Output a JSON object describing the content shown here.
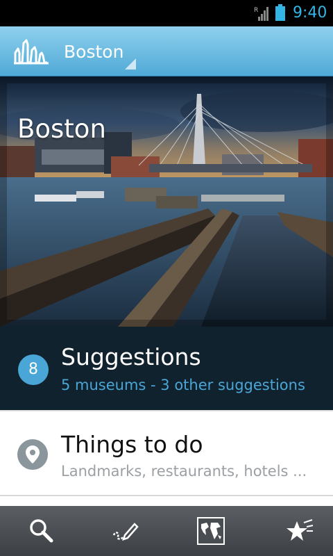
{
  "status_bar": {
    "time": "9:40",
    "icons": [
      "signal-icon",
      "battery-icon"
    ],
    "accent_color": "#33b5e5"
  },
  "action_bar": {
    "app_icon": "city-skyline-logo-icon",
    "city_selector": "Boston",
    "background_color": "#6bbde4"
  },
  "hero": {
    "title": "Boston",
    "image": "photo of Boston harbor locks with the Zakim bridge"
  },
  "suggestions": {
    "count": "8",
    "title": "Suggestions",
    "subtitle": "5 museums - 3 other suggestions"
  },
  "things_to_do": {
    "icon": "map-pin-icon",
    "title": "Things to do",
    "subtitle": "Landmarks, restaurants, hotels ..."
  },
  "bottom_bar": {
    "items": [
      {
        "icon": "search-icon"
      },
      {
        "icon": "write-note-icon"
      },
      {
        "icon": "world-map-icon"
      },
      {
        "icon": "favorites-star-icon"
      }
    ]
  }
}
